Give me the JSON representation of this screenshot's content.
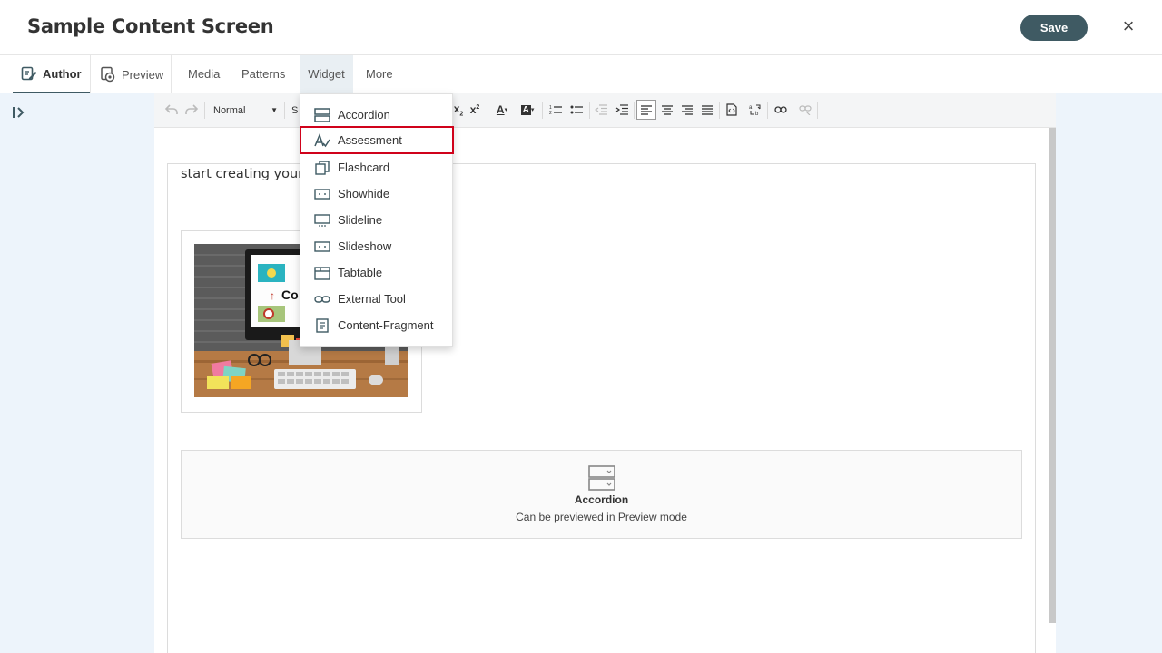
{
  "header": {
    "title": "Sample Content Screen",
    "save_label": "Save",
    "close_symbol": "×"
  },
  "tabs": {
    "author": "Author",
    "preview": "Preview"
  },
  "menu": {
    "media": "Media",
    "patterns": "Patterns",
    "widget": "Widget",
    "more": "More"
  },
  "toolbar": {
    "format_value": "Normal",
    "size_value": "Si"
  },
  "content": {
    "text": "start creating your c"
  },
  "accordion_block": {
    "title": "Accordion",
    "subtitle": "Can be previewed in Preview mode"
  },
  "dropdown": {
    "items": [
      {
        "label": "Accordion",
        "icon": "accordion-icon"
      },
      {
        "label": "Assessment",
        "icon": "assessment-icon",
        "highlighted": true
      },
      {
        "label": "Flashcard",
        "icon": "flashcard-icon"
      },
      {
        "label": "Showhide",
        "icon": "showhide-icon"
      },
      {
        "label": "Slideline",
        "icon": "slideline-icon"
      },
      {
        "label": "Slideshow",
        "icon": "slideshow-icon"
      },
      {
        "label": "Tabtable",
        "icon": "tabtable-icon"
      },
      {
        "label": "External Tool",
        "icon": "link-icon"
      },
      {
        "label": "Content-Fragment",
        "icon": "document-icon"
      }
    ]
  },
  "colors": {
    "save_button": "#3f5a63",
    "sidebar_bg": "#edf4fb",
    "highlight_outline": "#d0021b",
    "active_menu_bg": "#e9eff3"
  }
}
